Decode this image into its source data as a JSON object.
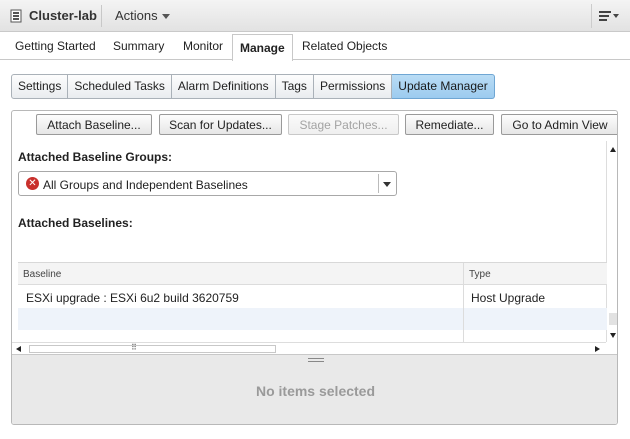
{
  "window": {
    "title": "Cluster-lab",
    "actions_label": "Actions"
  },
  "tabs": [
    {
      "label": "Getting Started"
    },
    {
      "label": "Summary"
    },
    {
      "label": "Monitor"
    },
    {
      "label": "Manage",
      "active": true
    },
    {
      "label": "Related Objects"
    }
  ],
  "subtabs": [
    {
      "label": "Settings"
    },
    {
      "label": "Scheduled Tasks"
    },
    {
      "label": "Alarm Definitions"
    },
    {
      "label": "Tags"
    },
    {
      "label": "Permissions"
    },
    {
      "label": "Update Manager",
      "active": true
    }
  ],
  "toolbar": {
    "attach_baseline": "Attach Baseline...",
    "scan_for_updates": "Scan for Updates...",
    "stage_patches": "Stage Patches...",
    "remediate": "Remediate...",
    "go_to_admin_view": "Go to Admin View"
  },
  "baseline_groups": {
    "label": "Attached Baseline Groups:",
    "selected": "All Groups and Independent Baselines",
    "status_icon": "error-icon"
  },
  "baselines": {
    "label": "Attached Baselines:",
    "columns": [
      "Baseline",
      "Type"
    ],
    "rows": [
      [
        "ESXi upgrade : ESXi 6u2 build 3620759",
        "Host Upgrade"
      ]
    ]
  },
  "detail": {
    "message": "No items selected"
  },
  "colors": {
    "active_subtab": "#9ccbef",
    "error": "#c9302c",
    "row_alt": "#eef3fa"
  }
}
